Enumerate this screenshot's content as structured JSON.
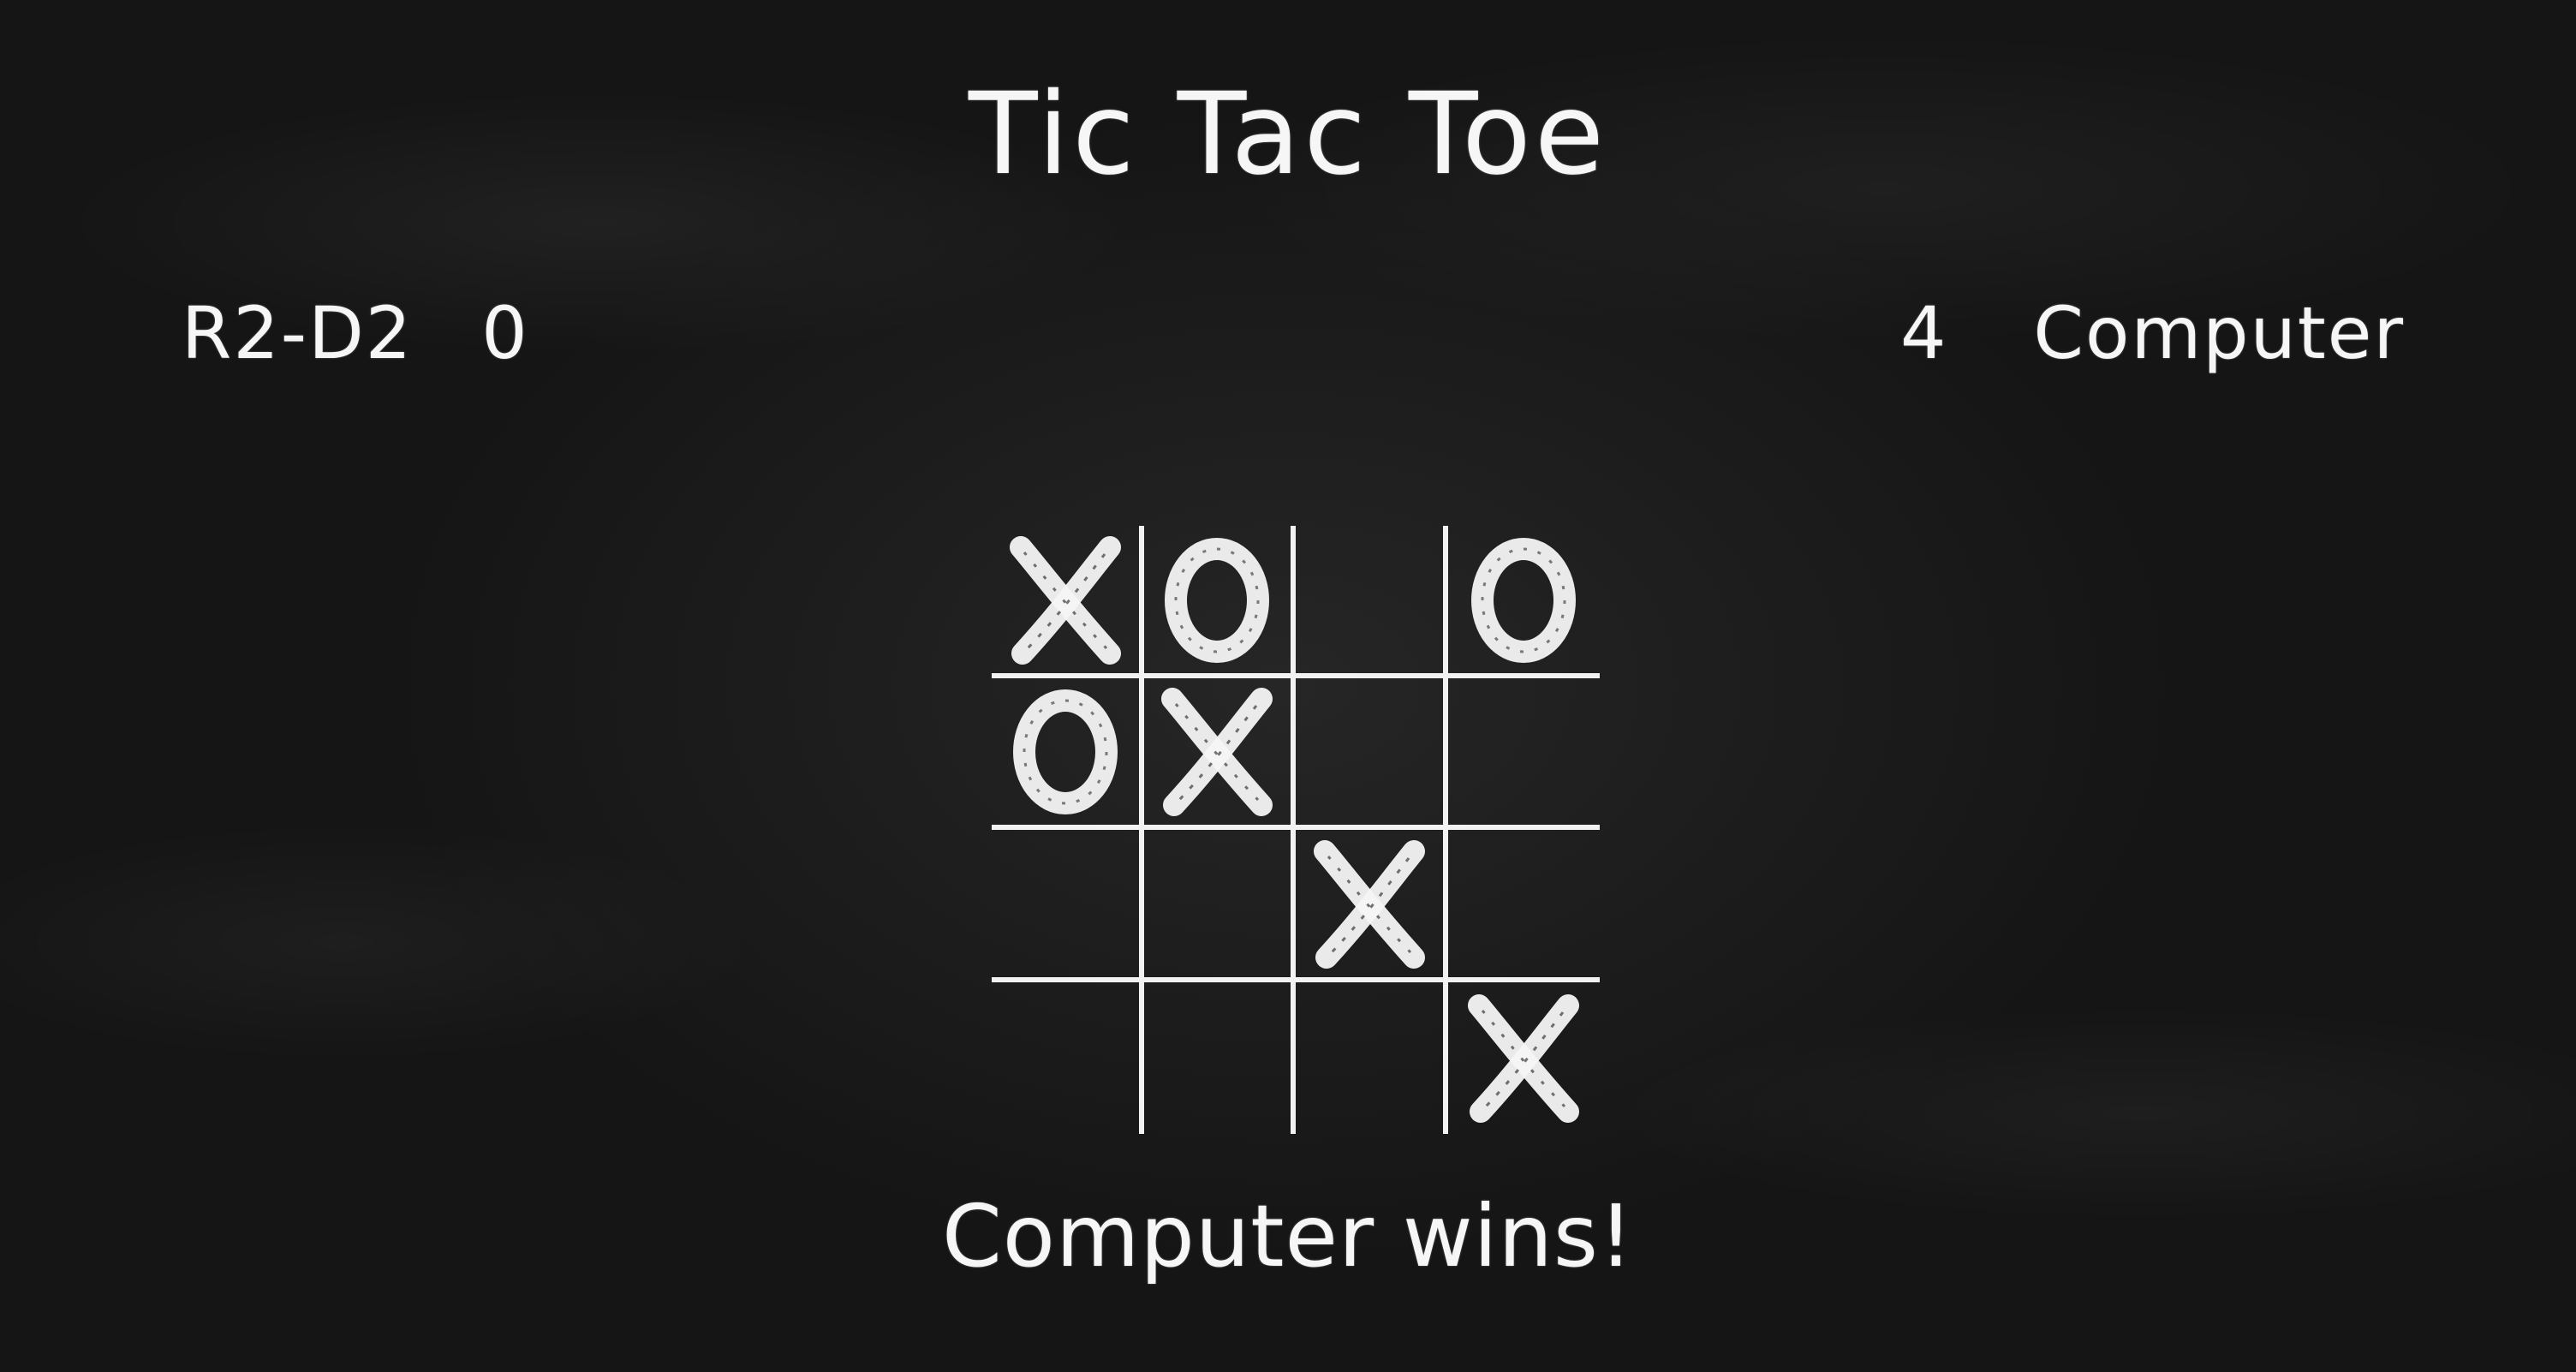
{
  "title": "Tic Tac Toe",
  "players": {
    "left": {
      "name": "R2-D2",
      "score": "0"
    },
    "right": {
      "name": "Computer",
      "score": "4"
    }
  },
  "board": [
    [
      "X",
      "O",
      "",
      "O"
    ],
    [
      "O",
      "X",
      "",
      ""
    ],
    [
      "",
      "",
      "X",
      ""
    ],
    [
      "",
      "",
      "",
      "X"
    ]
  ],
  "status": "Computer wins!",
  "colors": {
    "chalk": "#f4f4f4",
    "board_background": "#1b1b1b"
  }
}
